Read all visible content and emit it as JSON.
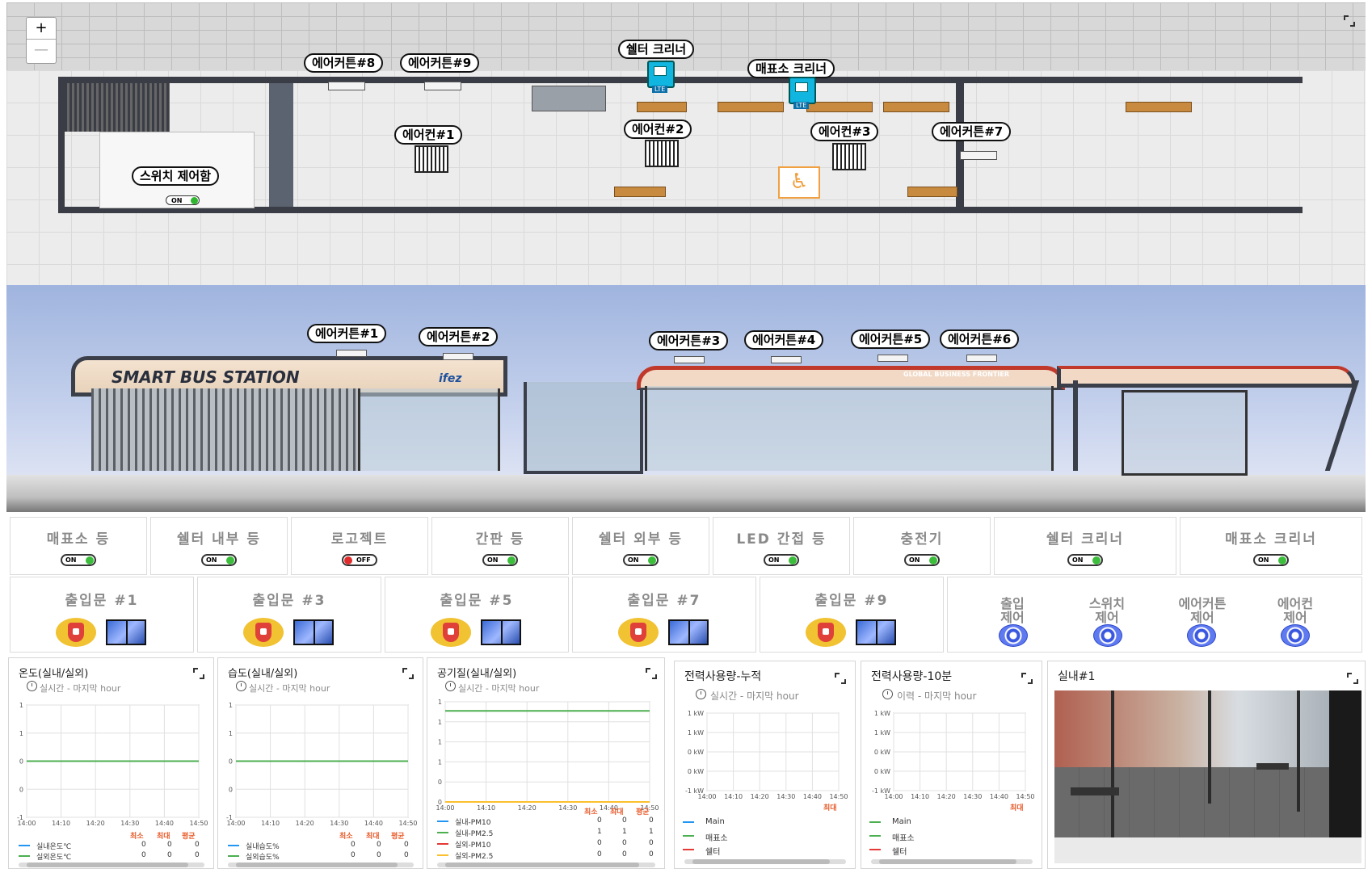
{
  "map": {
    "zoom_in": "+",
    "zoom_out": "—",
    "labels": {
      "aircurtain_8": "에어커튼#8",
      "aircurtain_9": "에어커튼#9",
      "shelter_cleaner": "쉘터 크리너",
      "kiosk_cleaner": "매표소 크리너",
      "aircon_1": "에어컨#1",
      "aircon_2": "에어컨#2",
      "aircon_3": "에어컨#3",
      "aircurtain_7": "에어커튼#7",
      "switch_box": "스위치 제어함",
      "switch_box_state": "ON",
      "cleaner_tag": "LTE"
    }
  },
  "elevation": {
    "sign": "SMART BUS STATION",
    "brand": "ifez",
    "banner": "GLOBAL BUSINESS FRONTIER",
    "labels": [
      "에어커튼#1",
      "에어커튼#2",
      "에어커튼#3",
      "에어커튼#4",
      "에어커튼#5",
      "에어커튼#6"
    ]
  },
  "switches": [
    {
      "label": "매표소 등",
      "state": "ON"
    },
    {
      "label": "쉘터 내부 등",
      "state": "ON"
    },
    {
      "label": "로고젝트",
      "state": "OFF"
    },
    {
      "label": "간판 등",
      "state": "ON"
    },
    {
      "label": "쉘터 외부 등",
      "state": "ON"
    },
    {
      "label": "LED 간접 등",
      "state": "ON"
    },
    {
      "label": "충전기",
      "state": "ON"
    },
    {
      "label": "쉘터 크리너",
      "state": "ON"
    },
    {
      "label": "매표소 크리너",
      "state": "ON"
    }
  ],
  "doors": [
    "출입문 #1",
    "출입문 #3",
    "출입문 #5",
    "출입문 #7",
    "출입문 #9"
  ],
  "actions": [
    {
      "line1": "출입",
      "line2": "제어"
    },
    {
      "line1": "스위치",
      "line2": "제어"
    },
    {
      "line1": "에어커튼",
      "line2": "제어"
    },
    {
      "line1": "에어컨",
      "line2": "제어"
    }
  ],
  "widgets": {
    "temp": {
      "title": "온도(실내/실외)",
      "subtitle": "실시간 - 마지막 hour",
      "stat_headers": [
        "최소",
        "최대",
        "평균"
      ],
      "rows": [
        {
          "name": "실내온도℃",
          "color": "#2196f3",
          "values": [
            "0",
            "0",
            "0"
          ]
        },
        {
          "name": "실외온도℃",
          "color": "#4caf50",
          "values": [
            "0",
            "0",
            "0"
          ]
        }
      ]
    },
    "humidity": {
      "title": "습도(실내/실외)",
      "subtitle": "실시간 - 마지막 hour",
      "stat_headers": [
        "최소",
        "최대",
        "평균"
      ],
      "rows": [
        {
          "name": "실내습도%",
          "color": "#2196f3",
          "values": [
            "0",
            "0",
            "0"
          ]
        },
        {
          "name": "실외습도%",
          "color": "#4caf50",
          "values": [
            "0",
            "0",
            "0"
          ]
        }
      ]
    },
    "air": {
      "title": "공기질(실내/실외)",
      "subtitle": "실시간 - 마지막 hour",
      "stat_headers": [
        "최소",
        "최대",
        "평균"
      ],
      "rows": [
        {
          "name": "실내-PM10",
          "color": "#2196f3",
          "values": [
            "0",
            "0",
            "0"
          ]
        },
        {
          "name": "실내-PM2.5",
          "color": "#4caf50",
          "values": [
            "1",
            "1",
            "1"
          ]
        },
        {
          "name": "실외-PM10",
          "color": "#e53935",
          "values": [
            "0",
            "0",
            "0"
          ]
        },
        {
          "name": "실외-PM2.5",
          "color": "#fbc02d",
          "values": [
            "0",
            "0",
            "0"
          ]
        }
      ]
    },
    "power_total": {
      "title": "전력사용량-누적",
      "subtitle": "실시간 - 마지막 hour",
      "stat_header": "최대",
      "rows": [
        {
          "name": "Main",
          "color": "#2196f3"
        },
        {
          "name": "매표소",
          "color": "#4caf50"
        },
        {
          "name": "쉘터",
          "color": "#e53935"
        }
      ]
    },
    "power_10": {
      "title": "전력사용량-10분",
      "subtitle": "이력 - 마지막 hour",
      "stat_header": "최대",
      "rows": [
        {
          "name": "Main",
          "color": "#4caf50"
        },
        {
          "name": "매표소",
          "color": "#4caf50"
        },
        {
          "name": "쉘터",
          "color": "#e53935"
        }
      ]
    },
    "camera": {
      "title": "실내#1"
    }
  },
  "chart_data": [
    {
      "type": "line",
      "title": "온도(실내/실외)",
      "x": [
        "14:00",
        "14:10",
        "14:20",
        "14:30",
        "14:40",
        "14:50"
      ],
      "y_ticks": [
        "1",
        "1",
        "0",
        "0",
        "-1"
      ],
      "series": [
        {
          "name": "실내온도℃",
          "values": [
            0,
            0,
            0,
            0,
            0,
            0
          ]
        },
        {
          "name": "실외온도℃",
          "values": [
            0,
            0,
            0,
            0,
            0,
            0
          ]
        }
      ]
    },
    {
      "type": "line",
      "title": "습도(실내/실외)",
      "x": [
        "14:00",
        "14:10",
        "14:20",
        "14:30",
        "14:40",
        "14:50"
      ],
      "y_ticks": [
        "1",
        "1",
        "0",
        "0",
        "-1"
      ],
      "series": [
        {
          "name": "실내습도%",
          "values": [
            0,
            0,
            0,
            0,
            0,
            0
          ]
        },
        {
          "name": "실외습도%",
          "values": [
            0,
            0,
            0,
            0,
            0,
            0
          ]
        }
      ]
    },
    {
      "type": "line",
      "title": "공기질(실내/실외)",
      "x": [
        "14:00",
        "14:10",
        "14:20",
        "14:30",
        "14:40",
        "14:50"
      ],
      "y_ticks": [
        "1",
        "1",
        "1",
        "1",
        "0",
        "0"
      ],
      "series": [
        {
          "name": "실내-PM10",
          "values": [
            0,
            0,
            0,
            0,
            0,
            0
          ]
        },
        {
          "name": "실내-PM2.5",
          "values": [
            1,
            1,
            1,
            1,
            1,
            1
          ]
        },
        {
          "name": "실외-PM10",
          "values": [
            0,
            0,
            0,
            0,
            0,
            0
          ]
        },
        {
          "name": "실외-PM2.5",
          "values": [
            0,
            0,
            0,
            0,
            0,
            0
          ]
        }
      ]
    },
    {
      "type": "line",
      "title": "전력사용량-누적",
      "x": [
        "14:00",
        "14:10",
        "14:20",
        "14:30",
        "14:40",
        "14:50"
      ],
      "y_ticks": [
        "1 kW",
        "1 kW",
        "0 kW",
        "0 kW",
        "-1 kW"
      ],
      "series": []
    },
    {
      "type": "line",
      "title": "전력사용량-10분",
      "x": [
        "14:00",
        "14:10",
        "14:20",
        "14:30",
        "14:40",
        "14:50"
      ],
      "y_ticks": [
        "1 kW",
        "1 kW",
        "0 kW",
        "0 kW",
        "-1 kW"
      ],
      "series": []
    }
  ]
}
